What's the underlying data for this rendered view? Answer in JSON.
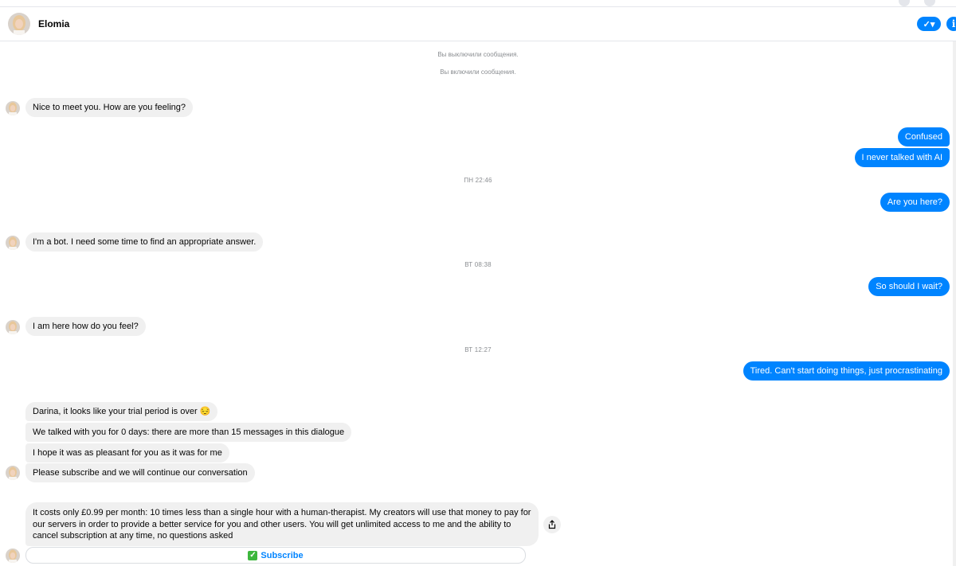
{
  "header": {
    "contact_name": "Elomia",
    "check_icon": "check-icon",
    "info_icon": "info-icon",
    "colors": {
      "accent": "#0084ff"
    }
  },
  "system_messages": [
    "Вы выключили сообщения.",
    "Вы включили сообщения."
  ],
  "timestamps": {
    "t1": "ПН 22:46",
    "t2": "ВТ 08:38",
    "t3": "ВТ 12:27"
  },
  "messages": {
    "m1": "Nice to meet you. How are you feeling?",
    "m2": "Confused",
    "m3": "I never talked with AI",
    "m4": "Are you here?",
    "m5": "I'm a bot. I need some time to find an appropriate answer.",
    "m6": "So should I wait?",
    "m7": "I am here how do you feel?",
    "m8": "Tired. Can't start doing things, just procrastinating",
    "m9": "Darina, it looks like your trial period is over",
    "m9_emoji": "😔",
    "m10": "We talked with you for 0 days: there are more than 15 messages in this dialogue",
    "m11": "I hope it was as pleasant for you as it was for me",
    "m12": "Please subscribe and we will continue our conversation",
    "m13": "It costs only £0.99 per month: 10 times less than a single hour with a human-therapist. My creators will use that money to pay for our servers in order to provide a better service for you and other users. You will get unlimited access to me and the ability to cancel subscription at any time, no questions asked"
  },
  "subscribe": {
    "label": "Subscribe",
    "icon": "check-mark-button-icon"
  },
  "share_icon": "share-icon"
}
